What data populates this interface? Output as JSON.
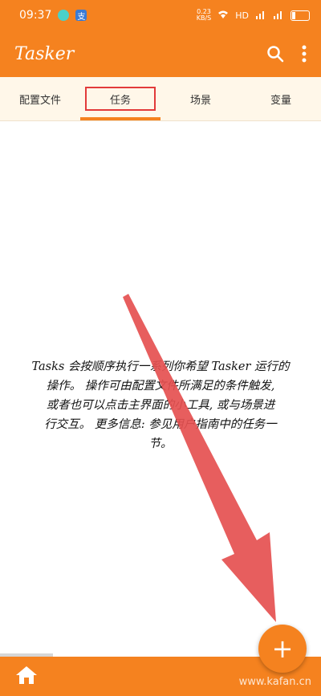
{
  "status": {
    "time": "09:37",
    "app_icon_label": "支",
    "speed_value": "0.23",
    "speed_unit": "KB/S",
    "network": "HD",
    "battery_text": "",
    "battery_level": 0.2
  },
  "appbar": {
    "title": "Tasker"
  },
  "tabs": [
    {
      "label": "配置文件"
    },
    {
      "label": "任务"
    },
    {
      "label": "场景"
    },
    {
      "label": "变量"
    }
  ],
  "empty_state": {
    "line1": "Tasks 会按顺序执行一系列你希望 Tasker 运行的",
    "line2": "操作。 操作可由配置文件所满足的条件触发,",
    "line3": "或者也可以点击主界面的小工具, 或与场景进",
    "line4": "行交互。 更多信息: 参见用户指南中的任务一",
    "line5": "节。"
  },
  "fab": {
    "label": "+"
  },
  "watermark": "www.kafan.cn",
  "colors": {
    "accent": "#f5821f",
    "tab_bg": "#fff7e9",
    "highlight": "#e23a3a",
    "arrow": "#e55050"
  }
}
